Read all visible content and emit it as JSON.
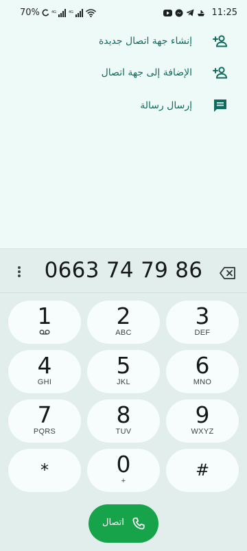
{
  "status_bar": {
    "battery": "70%",
    "time": "11:25"
  },
  "actions": [
    {
      "label": "إنشاء جهة اتصال جديدة",
      "icon": "add-person-icon"
    },
    {
      "label": "الإضافة إلى جهة اتصال",
      "icon": "add-person-icon"
    },
    {
      "label": "إرسال رسالة",
      "icon": "message-icon"
    }
  ],
  "dialer": {
    "number": "0663 74 79 86",
    "keys": [
      {
        "digit": "1",
        "letters": ""
      },
      {
        "digit": "2",
        "letters": "ABC"
      },
      {
        "digit": "3",
        "letters": "DEF"
      },
      {
        "digit": "4",
        "letters": "GHI"
      },
      {
        "digit": "5",
        "letters": "JKL"
      },
      {
        "digit": "6",
        "letters": "MNO"
      },
      {
        "digit": "7",
        "letters": "PQRS"
      },
      {
        "digit": "8",
        "letters": "TUV"
      },
      {
        "digit": "9",
        "letters": "WXYZ"
      },
      {
        "digit": "*",
        "letters": ""
      },
      {
        "digit": "0",
        "letters": "+"
      },
      {
        "digit": "#",
        "letters": ""
      }
    ],
    "call_label": "اتصال"
  },
  "colors": {
    "accent_text": "#0f6b5e",
    "call_button": "#16a34a",
    "background": "#eefaf8",
    "pad_background": "#e1eeec"
  }
}
